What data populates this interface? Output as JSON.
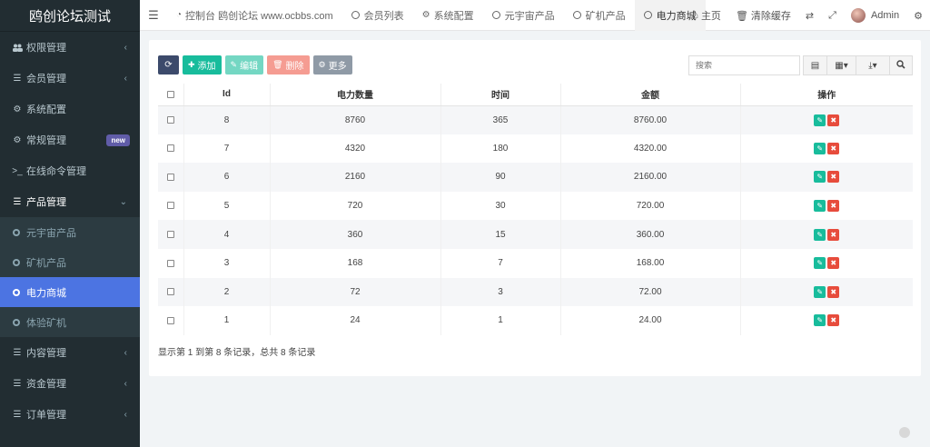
{
  "app": {
    "title": "鸥创论坛测试"
  },
  "sidebar": {
    "items": [
      {
        "icon": "users-icon",
        "label": "权限管理",
        "caret": "‹"
      },
      {
        "icon": "list-icon",
        "label": "会员管理",
        "caret": "‹"
      },
      {
        "icon": "gear-icon",
        "label": "系统配置",
        "caret": ""
      },
      {
        "icon": "cogs-icon",
        "label": "常规管理",
        "badge": "new"
      },
      {
        "icon": "terminal-icon",
        "label": "在线命令管理",
        "caret": ""
      },
      {
        "icon": "list-icon",
        "label": "产品管理",
        "caret": "⌄"
      }
    ],
    "subitems": [
      {
        "label": "元宇宙产品"
      },
      {
        "label": "矿机产品"
      },
      {
        "label": "电力商城"
      },
      {
        "label": "体验矿机"
      }
    ],
    "bottom_items": [
      {
        "icon": "list-icon",
        "label": "内容管理",
        "caret": "‹"
      },
      {
        "icon": "list-icon",
        "label": "资金管理",
        "caret": "‹"
      },
      {
        "icon": "list-icon",
        "label": "订单管理",
        "caret": "‹"
      }
    ]
  },
  "topbar": {
    "tabs": [
      {
        "label": "控制台 鸥创论坛 www.ocbbs.com"
      },
      {
        "label": "会员列表"
      },
      {
        "label": "系统配置"
      },
      {
        "label": "元宇宙产品"
      },
      {
        "label": "矿机产品"
      },
      {
        "label": "电力商城"
      }
    ],
    "home": "主页",
    "clear_cache": "清除缓存",
    "user": "Admin"
  },
  "toolbar": {
    "add": "添加",
    "edit": "编辑",
    "delete": "删除",
    "more": "更多",
    "search_placeholder": "搜索"
  },
  "table": {
    "headers": [
      "Id",
      "电力数量",
      "时间",
      "金额",
      "操作"
    ],
    "rows": [
      {
        "id": "8",
        "qty": "8760",
        "time": "365",
        "amount": "8760.00"
      },
      {
        "id": "7",
        "qty": "4320",
        "time": "180",
        "amount": "4320.00"
      },
      {
        "id": "6",
        "qty": "2160",
        "time": "90",
        "amount": "2160.00"
      },
      {
        "id": "5",
        "qty": "720",
        "time": "30",
        "amount": "720.00"
      },
      {
        "id": "4",
        "qty": "360",
        "time": "15",
        "amount": "360.00"
      },
      {
        "id": "3",
        "qty": "168",
        "time": "7",
        "amount": "168.00"
      },
      {
        "id": "2",
        "qty": "72",
        "time": "3",
        "amount": "72.00"
      },
      {
        "id": "1",
        "qty": "24",
        "time": "1",
        "amount": "24.00"
      }
    ]
  },
  "pagination": {
    "info": "显示第 1 到第 8 条记录，总共 8 条记录"
  },
  "colors": {
    "sidebar_bg": "#222d32",
    "active": "#4c74e2",
    "success": "#18bc9c",
    "danger": "#e74c3c"
  }
}
